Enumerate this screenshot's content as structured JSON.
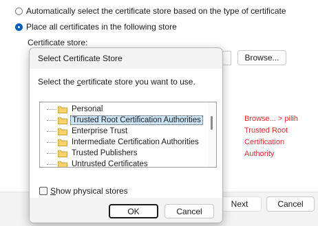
{
  "wizard": {
    "option_auto": "Automatically select the certificate store based on the type of certificate",
    "option_place": "Place all certificates in the following store",
    "store_label": "Certificate store:",
    "browse_label": "Browse...",
    "next_label": "Next",
    "cancel_label": "Cancel"
  },
  "annotation": "Browse... > pilih\nTrusted Root\nCertification\nAuthority",
  "dialog": {
    "title": "Select Certificate Store",
    "prompt_pre": "Select the ",
    "prompt_underlined": "c",
    "prompt_post": "ertificate store you want to use.",
    "stores": [
      "Personal",
      "Trusted Root Certification Authorities",
      "Enterprise Trust",
      "Intermediate Certification Authorities",
      "Trusted Publishers",
      "Untrusted Certificates"
    ],
    "selected_store": "Trusted Root Certification Authorities",
    "checkbox_underlined": "S",
    "checkbox_rest": "how physical stores",
    "ok_label": "OK",
    "cancel_label": "Cancel"
  },
  "colors": {
    "accent": "#005fb8",
    "annotation": "#d32f2f",
    "selection": "#cce4f7"
  }
}
